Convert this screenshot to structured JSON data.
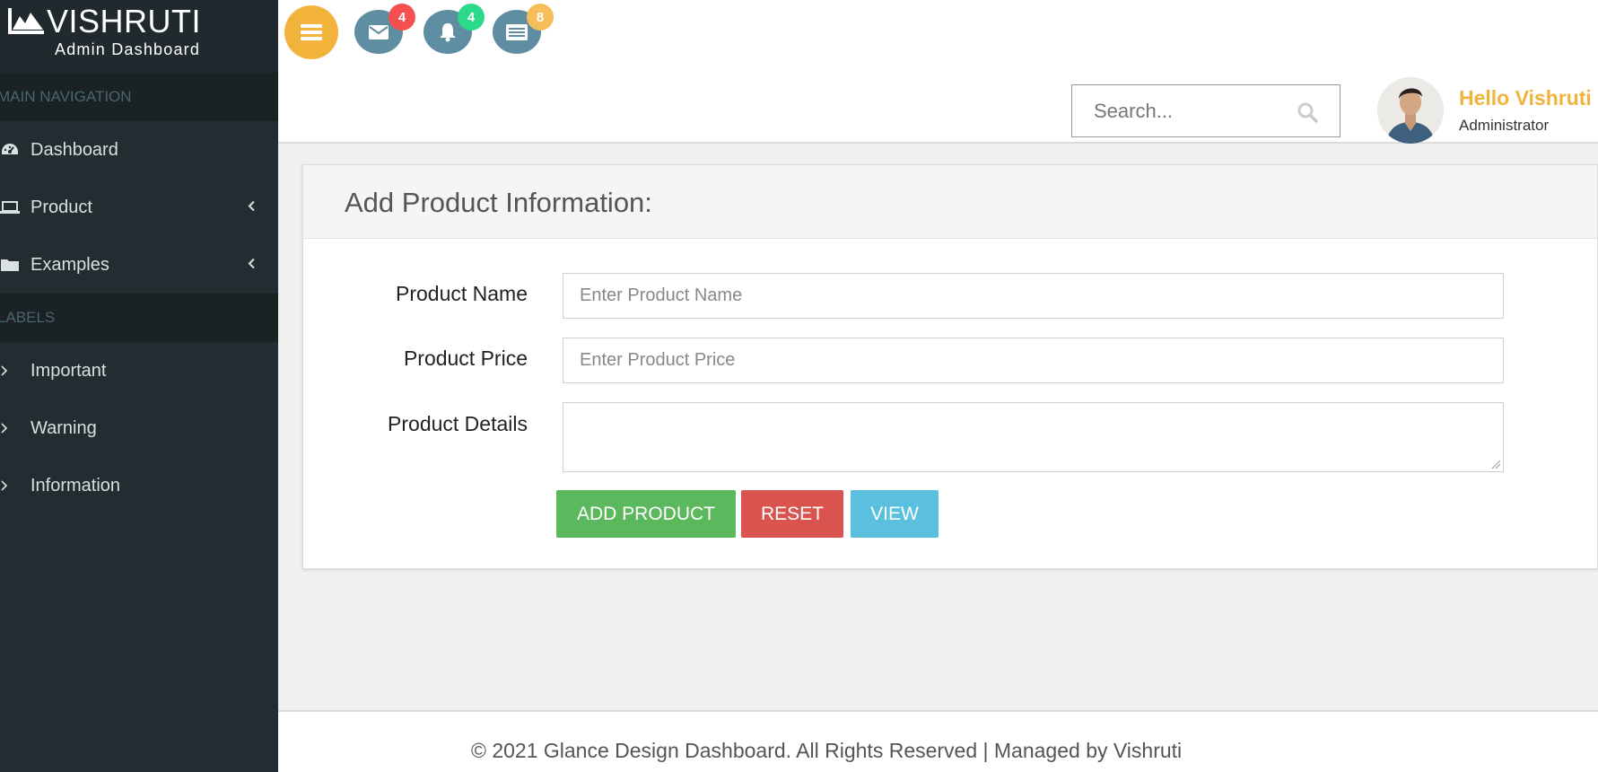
{
  "brand": {
    "title": "VISHRUTI",
    "subtitle": "Admin Dashboard"
  },
  "sidebar": {
    "main_header": "MAIN NAVIGATION",
    "main_items": [
      {
        "label": "Dashboard",
        "icon": "dashboard-icon"
      },
      {
        "label": "Product",
        "icon": "laptop-icon",
        "chevron": "chevron-left-icon"
      },
      {
        "label": "Examples",
        "icon": "folder-icon",
        "chevron": "chevron-left-icon"
      }
    ],
    "labels_header": "LABELS",
    "label_items": [
      {
        "label": "Important",
        "icon": "chevron-right-icon"
      },
      {
        "label": "Warning",
        "icon": "chevron-right-icon"
      },
      {
        "label": "Information",
        "icon": "chevron-right-icon"
      }
    ]
  },
  "topbar": {
    "menu_icon": "hamburger-icon",
    "notifications": [
      {
        "icon": "envelope-icon",
        "count": "4",
        "badge_color": "#f5504f"
      },
      {
        "icon": "bell-icon",
        "count": "4",
        "badge_color": "#2ad98a"
      },
      {
        "icon": "tasks-icon",
        "count": "8",
        "badge_color": "#f6be59"
      }
    ],
    "search": {
      "placeholder": "Search...",
      "icon": "search-icon"
    },
    "user": {
      "name": "Hello Vishruti",
      "role": "Administrator"
    }
  },
  "panel": {
    "title": "Add Product Information:",
    "fields": [
      {
        "label": "Product Name",
        "placeholder": "Enter Product Name",
        "value": ""
      },
      {
        "label": "Product Price",
        "placeholder": "Enter Product Price",
        "value": ""
      },
      {
        "label": "Product Details",
        "placeholder": "",
        "value": ""
      }
    ],
    "buttons": {
      "add": "ADD PRODUCT",
      "reset": "RESET",
      "view": "VIEW"
    }
  },
  "footer": {
    "text": "© 2021 Glance Design Dashboard. All Rights Reserved | Managed by Vishruti"
  },
  "colors": {
    "sidebar_bg": "#222d32",
    "accent": "#f2b33d",
    "success": "#5cb85c",
    "danger": "#d9534f",
    "info": "#5bc0de"
  }
}
